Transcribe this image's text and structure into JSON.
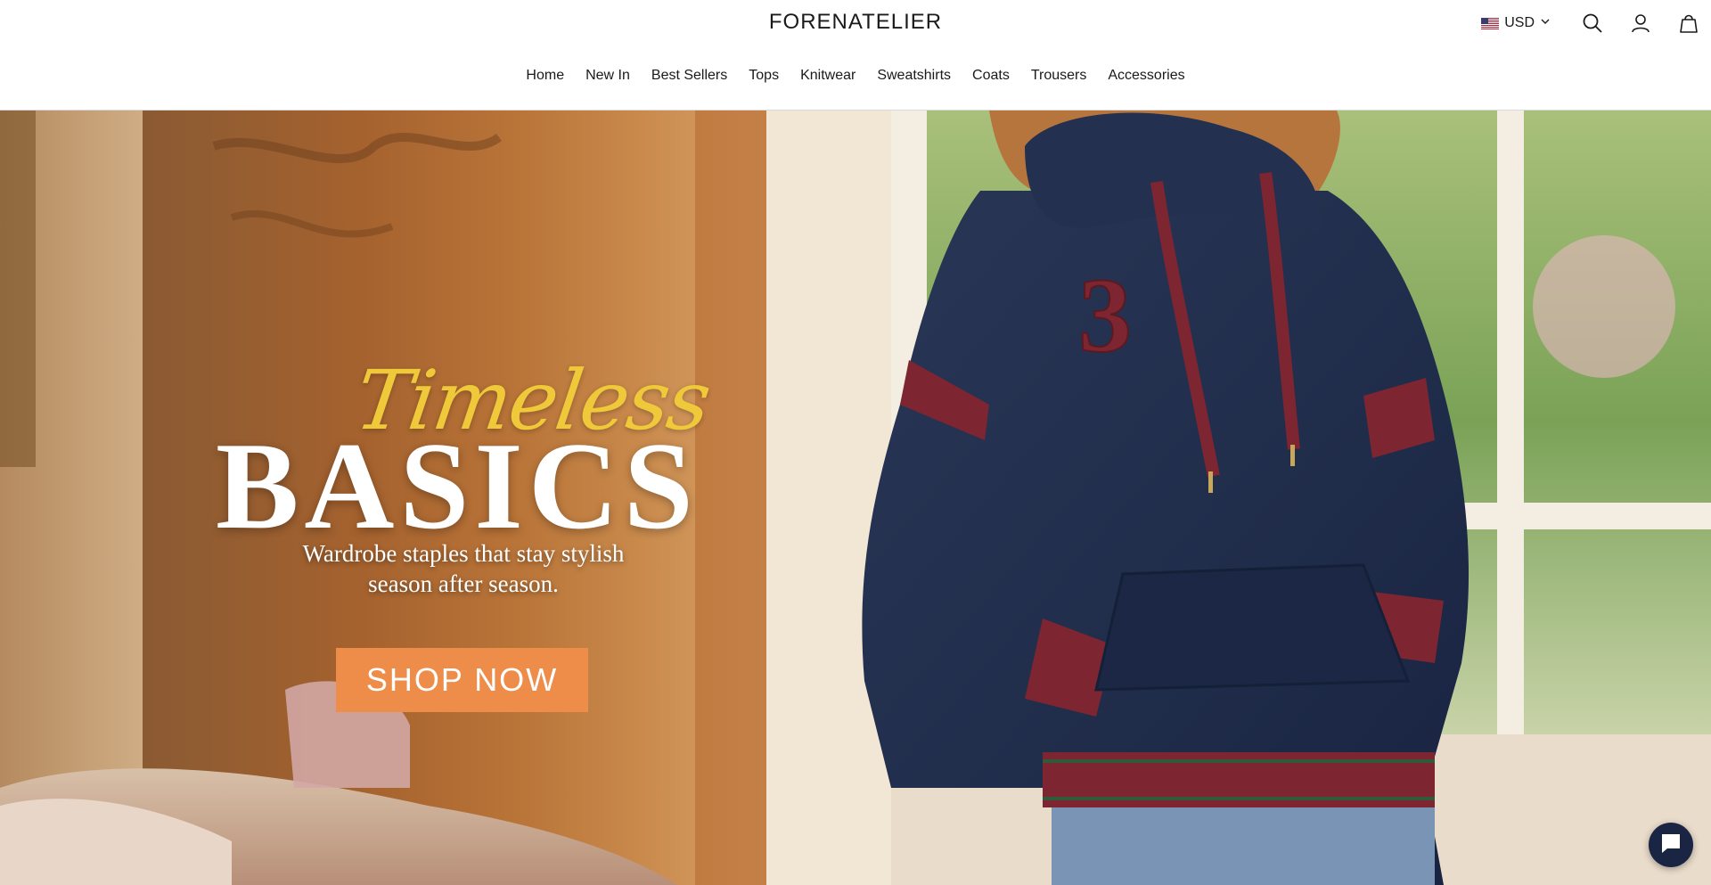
{
  "header": {
    "logo": "FORENATELIER",
    "currency": {
      "code": "USD",
      "flag": "us-flag-icon"
    },
    "icons": [
      "search-icon",
      "account-icon",
      "cart-icon"
    ]
  },
  "nav": {
    "items": [
      "Home",
      "New In",
      "Best Sellers",
      "Tops",
      "Knitwear",
      "Sweatshirts",
      "Coats",
      "Trousers",
      "Accessories"
    ]
  },
  "hero": {
    "script_title": "Timeless",
    "main_title": "BASICS",
    "subtitle_line1": "Wardrobe staples that stay stylish",
    "subtitle_line2": "season after season.",
    "cta": "SHOP NOW"
  },
  "colors": {
    "accent": "#ee8c4a",
    "script_gold": "#f0c93a",
    "hoodie_navy": "#1f2c4a",
    "chat_bg": "#1a2544"
  }
}
